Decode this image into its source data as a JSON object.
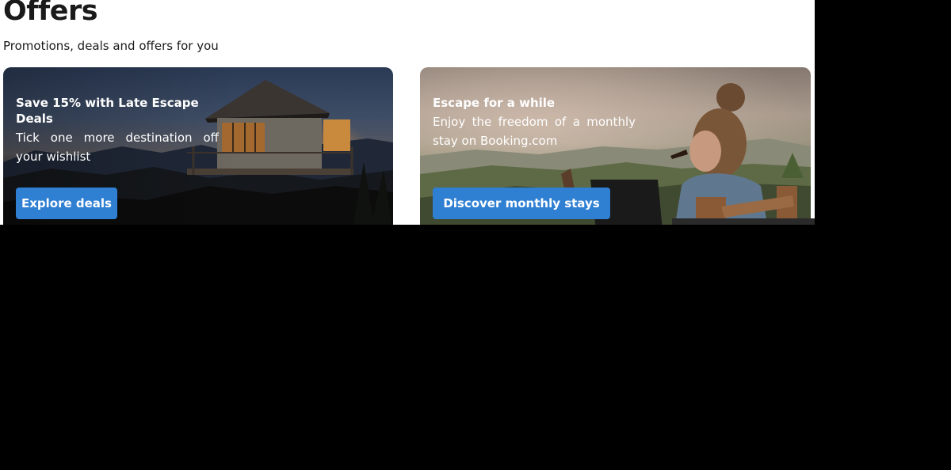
{
  "header": {
    "title": "Offers",
    "subtitle": "Promotions, deals and offers for you"
  },
  "cards": [
    {
      "title": "Save 15% with Late Escape Deals",
      "description": "Tick one more destination off your wishlist",
      "button_label": "Explore deals",
      "image": "cabin-lookout-sunset-photo"
    },
    {
      "title": "Escape for a while",
      "description": "Enjoy the freedom of a monthly stay on Booking.com",
      "button_label": "Discover monthly stays",
      "image": "woman-with-laptop-outdoors-photo"
    }
  ],
  "colors": {
    "button": "#2f7fd3",
    "page_background": "#ffffff",
    "title_text": "#1a1a1a"
  }
}
